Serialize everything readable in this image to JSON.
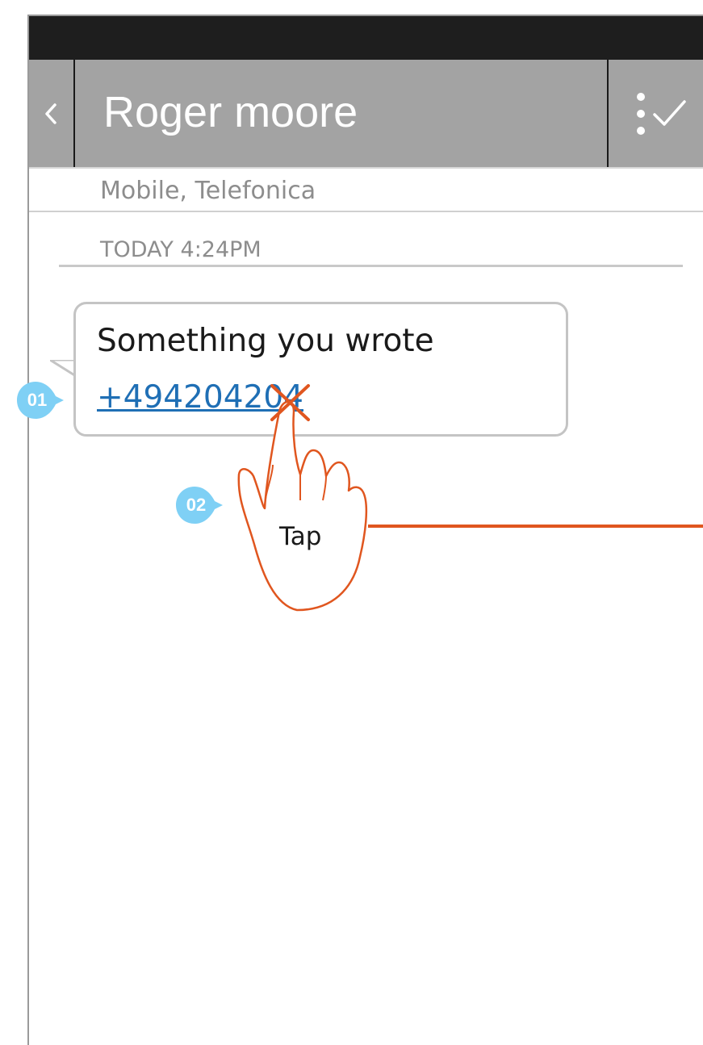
{
  "header": {
    "title": "Roger moore",
    "back_icon": "chevron-left-icon",
    "action_icon": "select-check-icon"
  },
  "contact": {
    "subtitle": "Mobile, Telefonica"
  },
  "thread": {
    "timestamp": "TODAY 4:24PM",
    "message": {
      "text": "Something you wrote",
      "link": "+494204204"
    }
  },
  "annotations": {
    "callout_1": "01",
    "callout_2": "02",
    "gesture_label": "Tap",
    "gesture_icon": "tap-hand-icon"
  },
  "colors": {
    "header_bg": "#a3a3a3",
    "status_bar": "#1e1e1e",
    "link": "#1f6fb5",
    "callout": "#7fd0f5",
    "gesture": "#e0561f"
  }
}
